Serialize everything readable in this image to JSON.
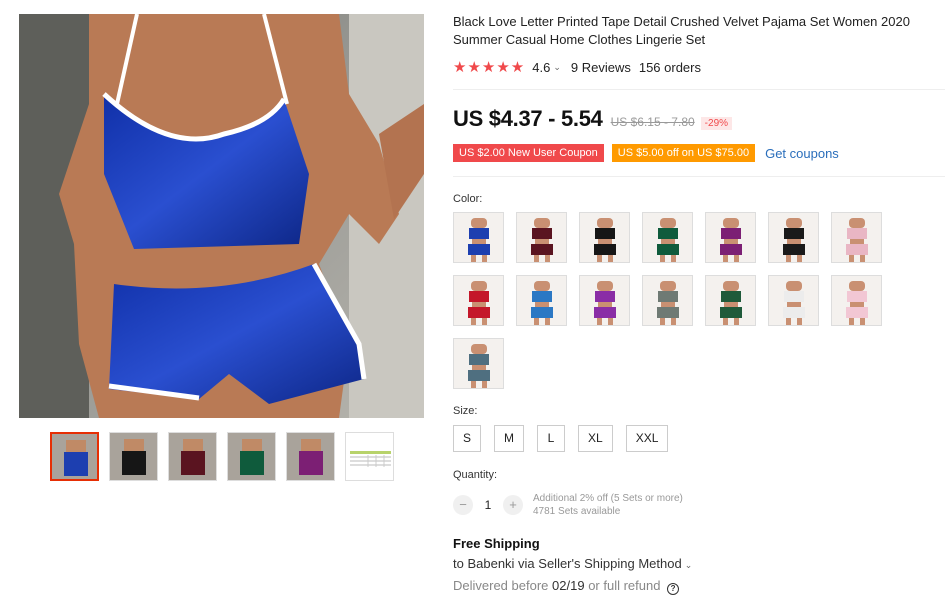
{
  "product": {
    "title": "Black Love Letter Printed Tape Detail Crushed Velvet Pajama Set Women 2020 Summer Casual Home Clothes Lingerie Set",
    "stars": "★★★★★",
    "rating": "4.6",
    "reviews": "9 Reviews",
    "orders": "156 orders",
    "price": "US $4.37 - 5.54",
    "original_price": "US $6.15 - 7.80",
    "discount": "-29%"
  },
  "coupons": {
    "new_user": "US $2.00 New User Coupon",
    "spend": "US $5.00 off on US $75.00",
    "get_link": "Get coupons"
  },
  "color": {
    "label": "Color:",
    "options": [
      {
        "name": "blue",
        "hex": "#1d3fb0"
      },
      {
        "name": "wine",
        "hex": "#5a1420"
      },
      {
        "name": "black",
        "hex": "#161616"
      },
      {
        "name": "green",
        "hex": "#0f5b3c"
      },
      {
        "name": "purple",
        "hex": "#7c1f74"
      },
      {
        "name": "black-lace",
        "hex": "#1a1a1a"
      },
      {
        "name": "pink-print",
        "hex": "#e9b6c4"
      },
      {
        "name": "red",
        "hex": "#c4172a"
      },
      {
        "name": "light-blue",
        "hex": "#2b78c4"
      },
      {
        "name": "violet",
        "hex": "#8a2da6"
      },
      {
        "name": "camo-grey",
        "hex": "#6f7a74"
      },
      {
        "name": "dark-green",
        "hex": "#1f5a3a"
      },
      {
        "name": "white-print",
        "hex": "#ececec"
      },
      {
        "name": "pink-white",
        "hex": "#f2c7d4"
      },
      {
        "name": "teal-grey",
        "hex": "#4f6f80"
      }
    ]
  },
  "size": {
    "label": "Size:",
    "options": [
      "S",
      "M",
      "L",
      "XL",
      "XXL"
    ]
  },
  "quantity": {
    "label": "Quantity:",
    "value": "1",
    "minus": "−",
    "plus": "+",
    "discount_note": "Additional 2% off (5 Sets or more)",
    "available": "4781 Sets available"
  },
  "shipping": {
    "title": "Free Shipping",
    "to_line": "to Babenki via Seller's Shipping Method",
    "delivered_prefix": "Delivered before",
    "date": "02/19",
    "suffix": "or full refund"
  },
  "gallery": {
    "thumb_colors": [
      "#1d3fb0",
      "#161616",
      "#5a1420",
      "#0f5b3c",
      "#7c1f74"
    ]
  }
}
